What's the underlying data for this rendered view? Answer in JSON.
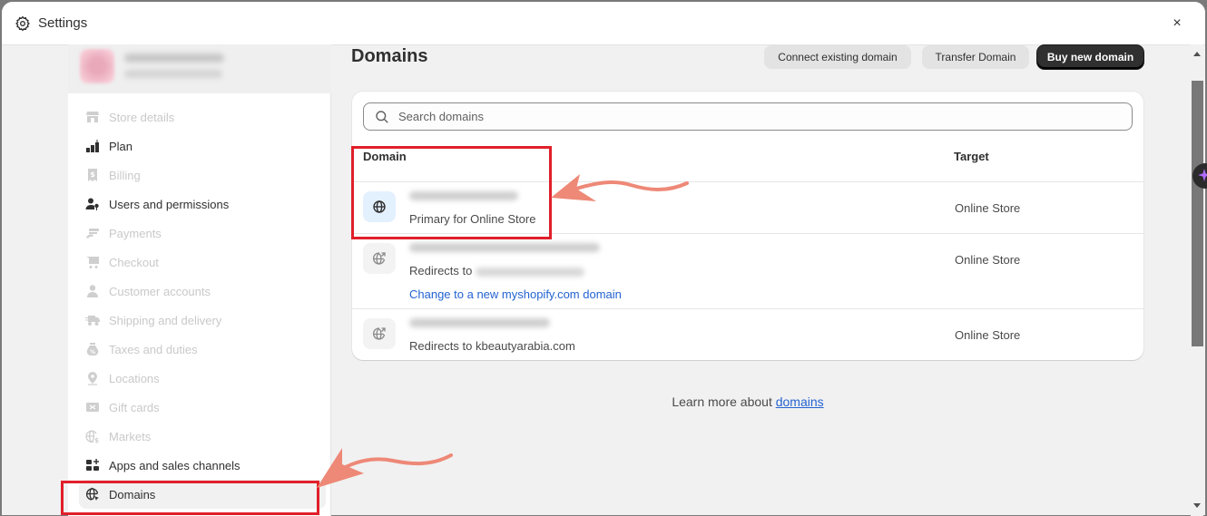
{
  "window": {
    "title": "Settings",
    "icons": {
      "title_icon": "gear-icon",
      "close_icon": "close-icon"
    },
    "close_label": "×"
  },
  "sidebar": {
    "store": {
      "name": "[blurred store name]",
      "url": "[blurred store url]"
    },
    "items": [
      {
        "label": "Store details",
        "icon": "store-icon",
        "state": "dimmed"
      },
      {
        "label": "Plan",
        "icon": "plan-icon",
        "state": "normal"
      },
      {
        "label": "Billing",
        "icon": "billing-icon",
        "state": "dimmed"
      },
      {
        "label": "Users and permissions",
        "icon": "users-icon",
        "state": "normal"
      },
      {
        "label": "Payments",
        "icon": "payments-icon",
        "state": "dimmed"
      },
      {
        "label": "Checkout",
        "icon": "cart-icon",
        "state": "dimmed"
      },
      {
        "label": "Customer accounts",
        "icon": "person-icon",
        "state": "dimmed"
      },
      {
        "label": "Shipping and delivery",
        "icon": "truck-icon",
        "state": "dimmed"
      },
      {
        "label": "Taxes and duties",
        "icon": "tax-bag-icon",
        "state": "dimmed"
      },
      {
        "label": "Locations",
        "icon": "location-pin-icon",
        "state": "dimmed"
      },
      {
        "label": "Gift cards",
        "icon": "gift-card-icon",
        "state": "dimmed"
      },
      {
        "label": "Markets",
        "icon": "globe-dollar-icon",
        "state": "dimmed"
      },
      {
        "label": "Apps and sales channels",
        "icon": "apps-icon",
        "state": "normal"
      },
      {
        "label": "Domains",
        "icon": "globe-cursor-icon",
        "state": "active"
      }
    ]
  },
  "main": {
    "title": "Domains",
    "buttons": {
      "connect": "Connect existing domain",
      "transfer": "Transfer Domain",
      "buy": "Buy new domain"
    },
    "search": {
      "placeholder": "Search domains",
      "value": ""
    },
    "table": {
      "columns": [
        "Domain",
        "Target"
      ],
      "rows": [
        {
          "domain": "[blurred]",
          "subtitle": "Primary for Online Store",
          "target": "Online Store",
          "icon": "globe-icon",
          "primary": true
        },
        {
          "domain": "[blurred].myshopify.com",
          "subtitle": "Redirects to",
          "subtitle_blurred": "[blurred].com",
          "link": "Change to a new myshopify.com domain",
          "target": "Online Store",
          "icon": "globe-redirect-icon"
        },
        {
          "domain": "[blurred].com",
          "subtitle": "Redirects to kbeautyarabia.com",
          "target": "Online Store",
          "icon": "globe-redirect-icon"
        }
      ]
    },
    "footer": {
      "text": "Learn more about ",
      "link": "domains"
    }
  },
  "annotations": {
    "highlight_color": "#e0202a",
    "arrow_color": "#ee8877",
    "highlights": [
      "domain-primary-row",
      "sidebar-item-domains"
    ]
  },
  "colors": {
    "primary_button": "#303030",
    "link": "#2463d1",
    "primary_icon_bg": "#e3f0fd",
    "assistant_accent": "#b06cff"
  }
}
